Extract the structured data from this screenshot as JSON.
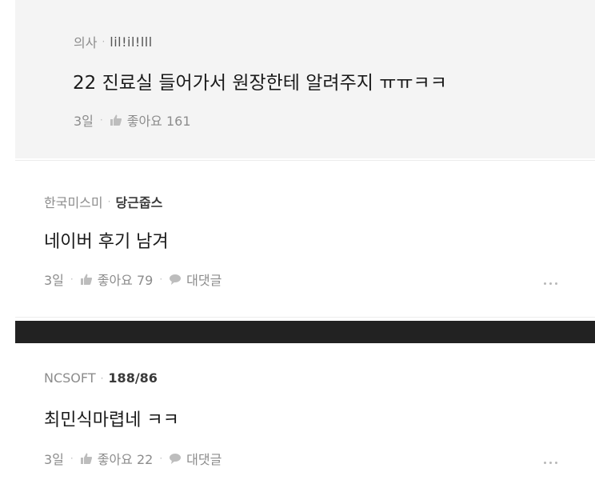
{
  "reply": {
    "company": "의사",
    "nickname": "lil!il!lll",
    "text": "22 진료실 들어가서 원장한테 알려주지 ㅠㅠㅋㅋ",
    "time": "3일",
    "like_label": "좋아요 161"
  },
  "comments": [
    {
      "company": "한국미스미",
      "nickname": "당근줍스",
      "text": "네이버 후기 남겨",
      "time": "3일",
      "like_label": "좋아요 79",
      "reply_label": "대댓글"
    },
    {
      "company": "NCSOFT",
      "nickname": "188/86",
      "text": "최민식마렵네 ㅋㅋ",
      "time": "3일",
      "like_label": "좋아요 22",
      "reply_label": "대댓글"
    }
  ],
  "separator": "·",
  "icons": {
    "like": "thumbs-up-icon",
    "reply": "speech-bubble-icon",
    "more": "more-dots-icon"
  },
  "colors": {
    "reply_background": "#f4f4f4",
    "section_divider": "#222222",
    "meta_text": "#8c8c8c",
    "body_text": "#1a1a1a"
  }
}
